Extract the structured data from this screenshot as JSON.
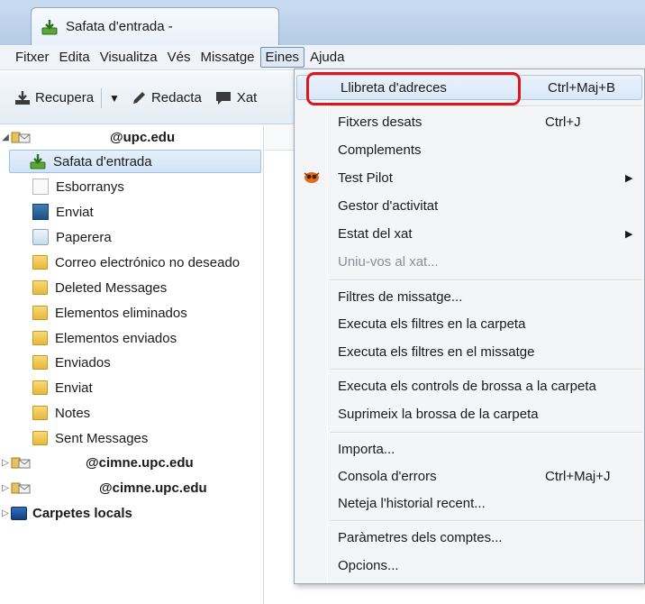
{
  "window": {
    "tab_title": "Safata d'entrada -"
  },
  "menubar": {
    "items": [
      "Fitxer",
      "Edita",
      "Visualitza",
      "Vés",
      "Missatge",
      "Eines",
      "Ajuda"
    ],
    "open": "Eines"
  },
  "toolbar": {
    "get_label": "Recupera",
    "write_label": "Redacta",
    "chat_label": "Xat"
  },
  "folders": {
    "account1": "@upc.edu",
    "items": [
      "Safata d'entrada",
      "Esborranys",
      "Enviat",
      "Paperera",
      "Correo electrónico no deseado",
      "Deleted Messages",
      "Elementos eliminados",
      "Elementos enviados",
      "Enviados",
      "Enviat",
      "Notes",
      "Sent Messages"
    ],
    "account2": "@cimne.upc.edu",
    "account3": "@cimne.upc.edu",
    "local": "Carpetes locals",
    "selected": "Safata d'entrada"
  },
  "tools_menu": {
    "address_book": "Llibreta d'adreces",
    "address_book_shortcut": "Ctrl+Maj+B",
    "saved_files": "Fitxers desats",
    "saved_files_shortcut": "Ctrl+J",
    "addons": "Complements",
    "test_pilot": "Test Pilot",
    "activity_manager": "Gestor d'activitat",
    "chat_status": "Estat del xat",
    "join_chat": "Uniu-vos al xat...",
    "message_filters": "Filtres de missatge...",
    "run_filters_folder": "Executa els filtres en la carpeta",
    "run_filters_message": "Executa els filtres en el missatge",
    "run_junk_controls": "Executa els controls de brossa a la carpeta",
    "delete_junk": "Suprimeix la brossa de la carpeta",
    "import": "Importa...",
    "error_console": "Consola d'errors",
    "error_console_shortcut": "Ctrl+Maj+J",
    "clear_history": "Neteja l'historial recent...",
    "account_settings": "Paràmetres dels comptes...",
    "options": "Opcions..."
  },
  "colors": {
    "highlight_box": "#e0141b",
    "selection": "#d2e3f6"
  }
}
